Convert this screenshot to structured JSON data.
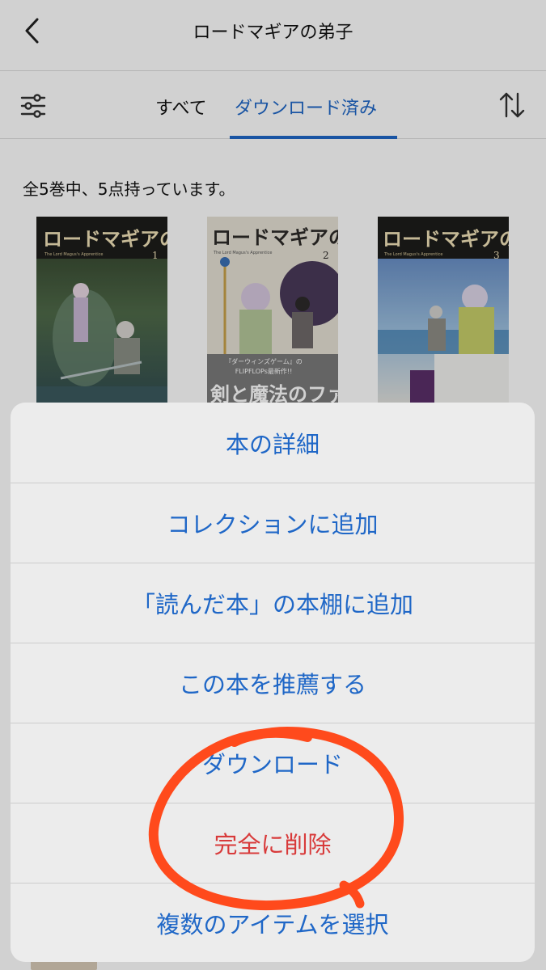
{
  "header": {
    "title": "ロードマギアの弟子"
  },
  "tabs": {
    "all": "すべて",
    "downloaded": "ダウンロード済み"
  },
  "summary": "全5巻中、5点持っています。",
  "covers": [
    {
      "title": "ロードマギアの弟子",
      "volume": "1",
      "subtitle": "The Lord Magus's Apprentice"
    },
    {
      "title": "ロードマギアの弟子",
      "volume": "2",
      "subtitle": "The Lord Magus's Apprentice",
      "band_top": "『ダーウィンズゲーム』の",
      "band_mid": "FLIPFLOPs最新作!!",
      "band_big": "剣と魔法のファンタジー"
    },
    {
      "title": "ロードマギアの弟子",
      "volume": "3",
      "subtitle": "The Lord Magus's Apprentice"
    }
  ],
  "action_sheet": {
    "items": [
      {
        "label": "本の詳細"
      },
      {
        "label": "コレクションに追加"
      },
      {
        "label": "「読んだ本」の本棚に追加"
      },
      {
        "label": "この本を推薦する"
      },
      {
        "label": "ダウンロード"
      },
      {
        "label": "完全に削除"
      },
      {
        "label": "複数のアイテムを選択"
      }
    ]
  },
  "colors": {
    "accent": "#1f67c7",
    "danger": "#d83a3a",
    "annotation": "#ff4a1c"
  }
}
